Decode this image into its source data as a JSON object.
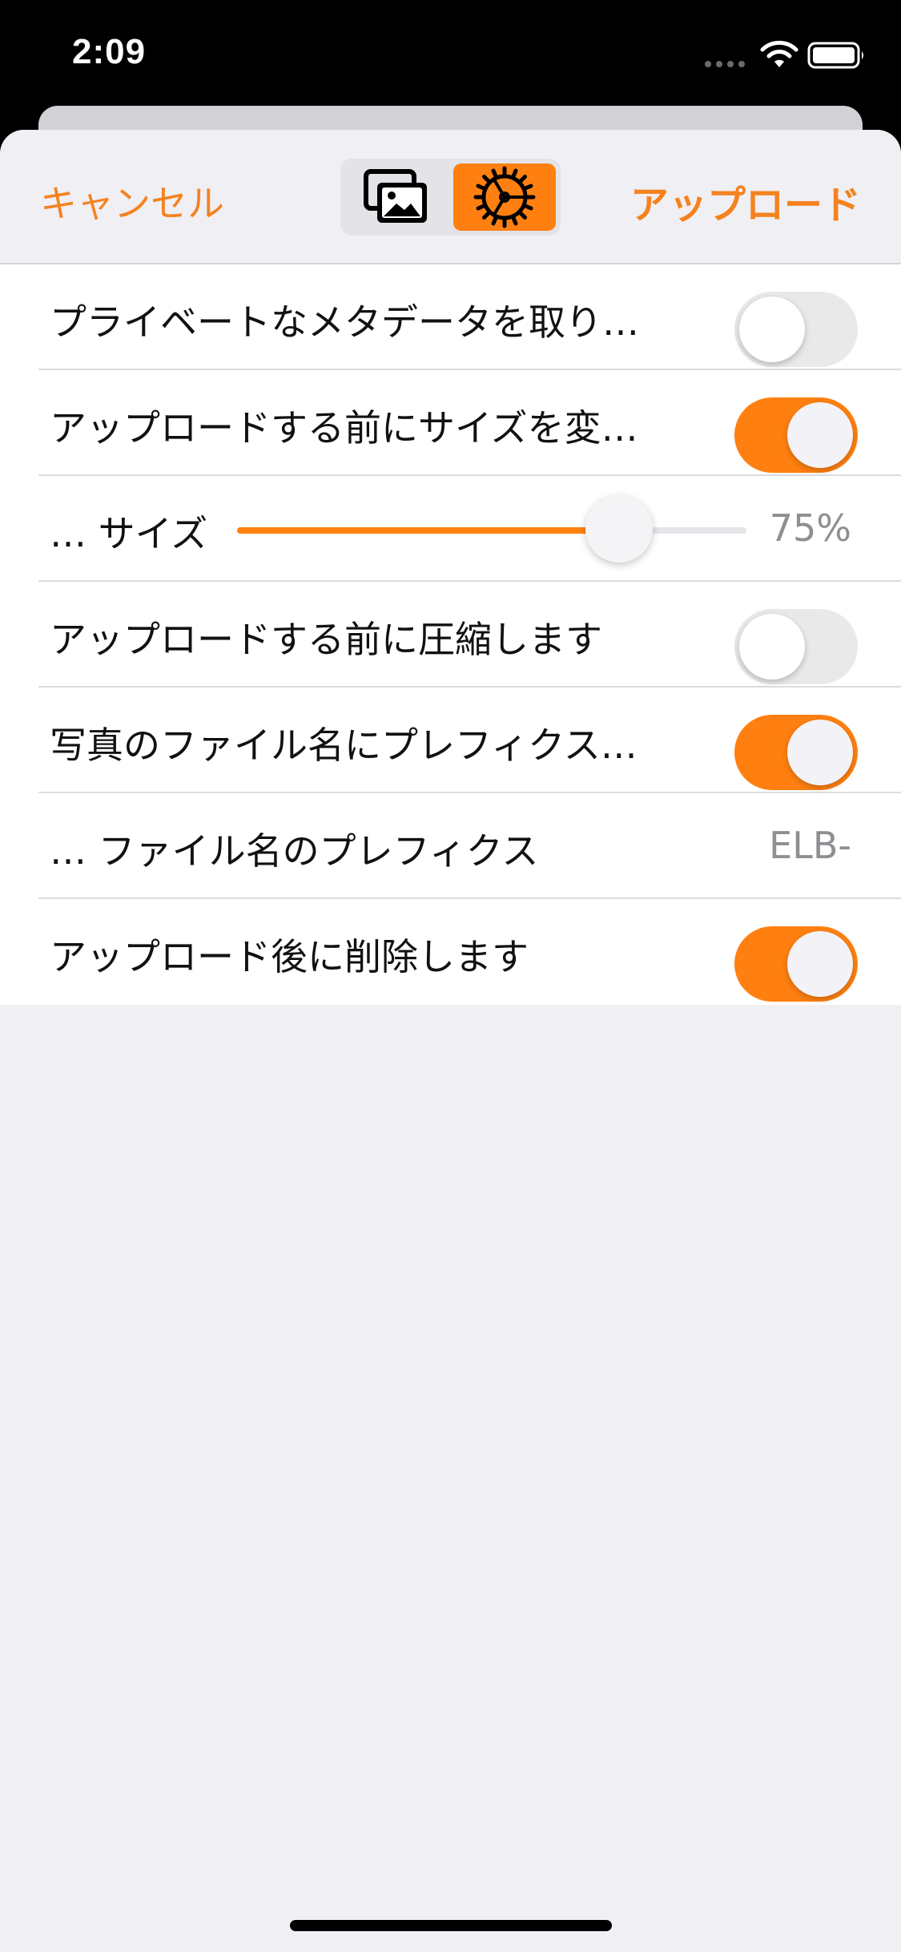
{
  "status_bar": {
    "time": "2:09"
  },
  "nav": {
    "cancel_label": "キャンセル",
    "upload_label": "アップロード",
    "segments": [
      {
        "icon": "photos-icon",
        "selected": false
      },
      {
        "icon": "gear-icon",
        "selected": true
      }
    ]
  },
  "settings": {
    "strip_metadata": {
      "label": "プライベートなメタデータを取り…",
      "on": false
    },
    "resize_before_upload": {
      "label": "アップロードする前にサイズを変…",
      "on": true
    },
    "size": {
      "label": "… サイズ",
      "value_text": "75%",
      "value": 0.75
    },
    "compress_before_upload": {
      "label": "アップロードする前に圧縮します",
      "on": false
    },
    "filename_prefix_toggle": {
      "label": "写真のファイル名にプレフィクス…",
      "on": true
    },
    "filename_prefix": {
      "label": "… ファイル名のプレフィクス",
      "value": "ELB-"
    },
    "delete_after_upload": {
      "label": "アップロード後に削除します",
      "on": true
    }
  },
  "colors": {
    "accent": "#ff8010",
    "toggle_off": "#e9e9ea",
    "background": "#efeff4"
  }
}
